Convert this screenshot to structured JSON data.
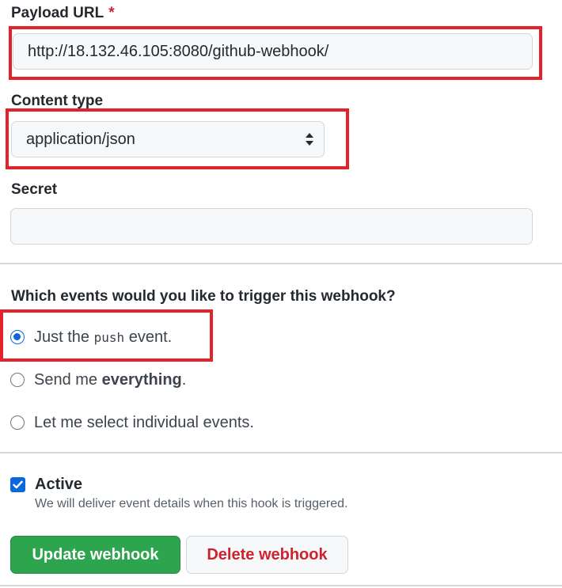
{
  "form": {
    "payload_url": {
      "label": "Payload URL",
      "required_marker": "*",
      "value": "http://18.132.46.105:8080/github-webhook/"
    },
    "content_type": {
      "label": "Content type",
      "selected": "application/json"
    },
    "secret": {
      "label": "Secret",
      "value": ""
    },
    "events": {
      "heading": "Which events would you like to trigger this webhook?",
      "options": [
        {
          "prefix": "Just the ",
          "code": "push",
          "suffix": " event.",
          "checked": true
        },
        {
          "prefix": "Send me ",
          "bold": "everything",
          "suffix": ".",
          "checked": false
        },
        {
          "text": "Let me select individual events.",
          "checked": false
        }
      ]
    },
    "active": {
      "label": "Active",
      "checked": true,
      "hint": "We will deliver event details when this hook is triggered."
    },
    "buttons": {
      "update": "Update webhook",
      "delete": "Delete webhook"
    }
  },
  "colors": {
    "annotation": "#e3222b",
    "primary": "#2da44e",
    "danger": "#cf222e",
    "accent": "#0969da"
  },
  "icons": {
    "select_arrows": "up-down-caret-icon",
    "checkbox_check": "check-icon"
  }
}
